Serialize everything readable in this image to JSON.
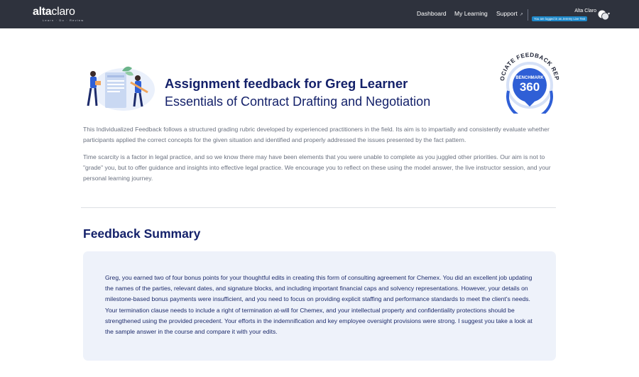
{
  "brand": {
    "logo_bold": "alta",
    "logo_thin": "claro",
    "tagline": "Learn · Do · Review"
  },
  "nav": {
    "dashboard": "Dashboard",
    "my_learning": "My Learning",
    "support": "Support",
    "support_icon": "external-link-icon"
  },
  "user": {
    "name": "Alta Claro",
    "login_notice": "You are logged in as Jeremy Live Test",
    "avatar_icon": "user-avatar-icon"
  },
  "header": {
    "title": "Assignment feedback for Greg Learner",
    "subtitle": "Essentials of Contract Drafting and Negotiation",
    "badge_ring_text": "ASSOCIATE FEEDBACK REPORT",
    "badge_label": "BENCHMARK",
    "badge_number": "360"
  },
  "intro": {
    "paragraph_1": "This Individualized Feedback follows a structured grading rubric developed by experienced practitioners in the field. Its aim is to impartially and consistently evaluate whether participants applied the correct concepts for the given situation and identified and properly addressed the issues presented by the fact pattern.",
    "paragraph_2": "Time scarcity is a factor in legal practice, and so we know there may have been elements that you were unable to complete as you juggled other priorities. Our aim is not to \"grade\" you, but to offer guidance and insights into effective legal practice. We encourage you to reflect on these using the model answer, the live instructor session, and your personal learning journey."
  },
  "summary": {
    "heading": "Feedback Summary",
    "body": "Greg, you earned two of four bonus points for your thoughtful edits in creating this form of consulting agreement for Chemex. You did an excellent job updating the names of the parties, relevant dates, and signature blocks, and including important financial caps and solvency representations. However, your details on milestone-based bonus payments were insufficient, and you need to focus on providing explicit staffing and performance standards to meet the client's needs. Your termination clause needs to include a right of termination at-will for Chemex, and your intellectual property and confidentiality protections should be strengthened using the provided precedent. Your efforts in the indemnification and key employee oversight provisions were strong. I suggest you take a look at the sample answer in the course and compare it with your edits."
  },
  "colors": {
    "navbar": "#2e323d",
    "heading_navy": "#14216a",
    "badge_blue": "#2f5fd6",
    "card_bg": "#eef2fa",
    "login_badge": "#1e88c9"
  }
}
